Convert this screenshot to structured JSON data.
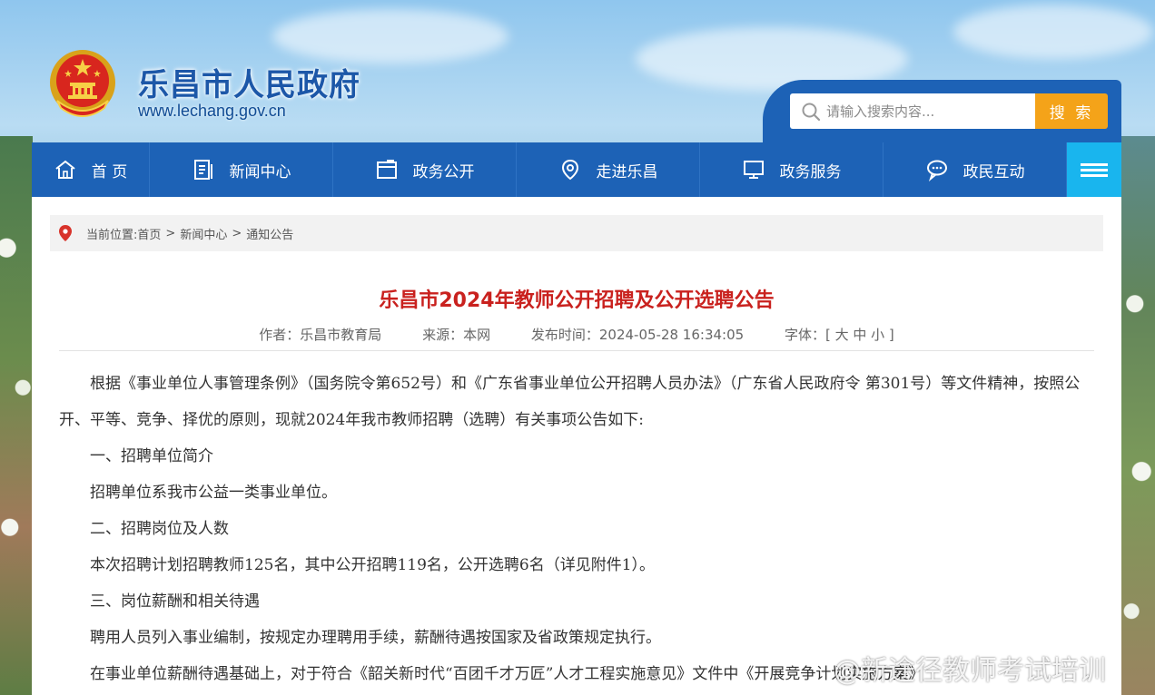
{
  "header": {
    "site_title": "乐昌市人民政府",
    "site_url": "www.lechang.gov.cn",
    "search_placeholder": "请输入搜索内容...",
    "search_button": "搜 索"
  },
  "nav": {
    "items": [
      {
        "label": "首 页",
        "icon": "home-icon"
      },
      {
        "label": "新闻中心",
        "icon": "news-icon"
      },
      {
        "label": "政务公开",
        "icon": "folder-icon"
      },
      {
        "label": "走进乐昌",
        "icon": "location-icon"
      },
      {
        "label": "政务服务",
        "icon": "monitor-icon"
      },
      {
        "label": "政民互动",
        "icon": "chat-icon"
      }
    ],
    "menu_icon": "hamburger-menu-icon"
  },
  "breadcrumb": {
    "prefix": "当前位置:",
    "items": [
      "首页",
      "新闻中心",
      "通知公告"
    ],
    "separator": ">"
  },
  "article": {
    "title": "乐昌市2024年教师公开招聘及公开选聘公告",
    "author": "作者：乐昌市教育局",
    "source": "来源：本网",
    "published": "发布时间：2024-05-28 16:34:05",
    "font_size": "字体：[ 大  中  小 ]",
    "paragraphs": [
      "根据《事业单位人事管理条例》（国务院令第652号）和《广东省事业单位公开招聘人员办法》（广东省人民政府令 第301号）等文件精神，按照公开、平等、竞争、择优的原则，现就2024年我市教师招聘（选聘）有关事项公告如下:",
      "一、招聘单位简介",
      "招聘单位系我市公益一类事业单位。",
      "二、招聘岗位及人数",
      "本次招聘计划招聘教师125名，其中公开招聘119名，公开选聘6名（详见附件1）。",
      "三、岗位薪酬和相关待遇",
      "聘用人员列入事业编制，按规定办理聘用手续，薪酬待遇按国家及省政策规定执行。",
      "在事业单位薪酬待遇基础上，对于符合《韶关新时代“百团千才万匠”人才工程实施意见》文件中《开展竞争计划实施方案》"
    ]
  },
  "watermark": "@新途径教师考试培训"
}
